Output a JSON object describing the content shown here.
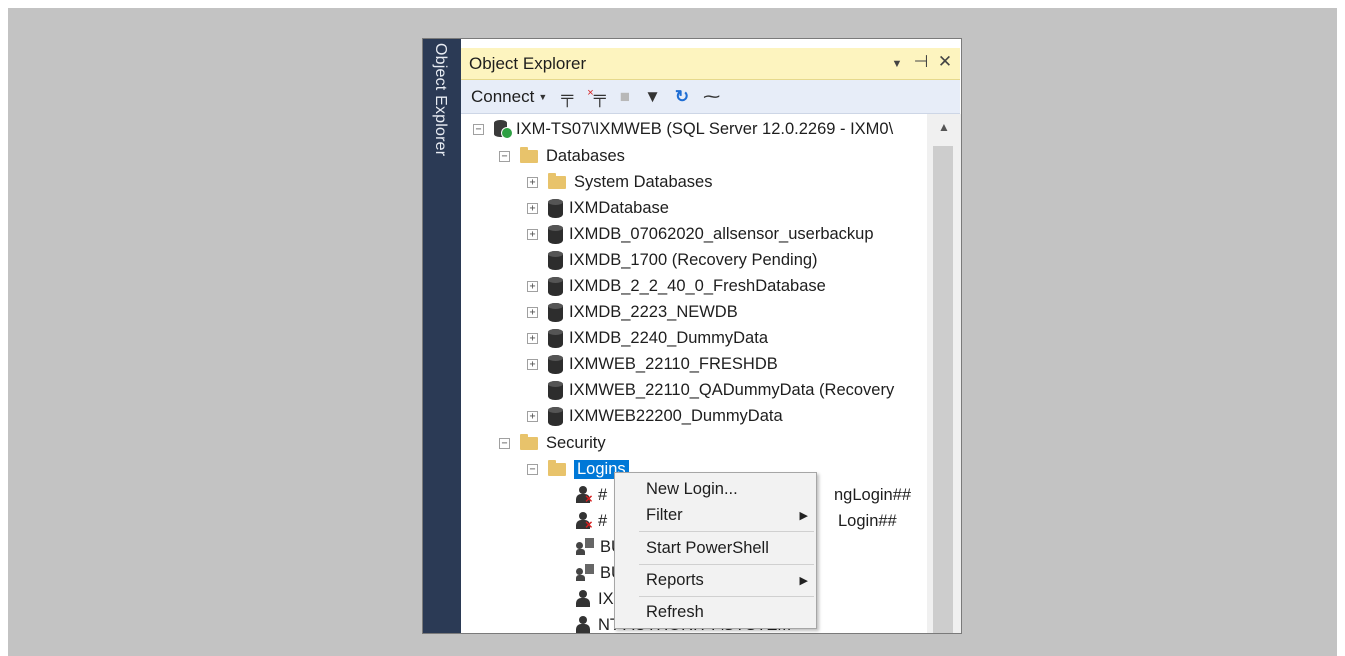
{
  "panel": {
    "side_tab": "Object Explorer",
    "title": "Object Explorer",
    "controls": [
      "▾",
      "⊣",
      "✕"
    ]
  },
  "toolbar": {
    "connect_label": "Connect",
    "icons": [
      "connect-plug-icon",
      "disconnect-icon",
      "stop-icon",
      "filter-icon",
      "refresh-icon",
      "activity-monitor-icon"
    ]
  },
  "tree": {
    "server": "IXM-TS07\\IXMWEB (SQL Server 12.0.2269 - IXM0\\",
    "databases_label": "Databases",
    "databases": [
      {
        "label": "System Databases",
        "type": "folder",
        "expandable": true
      },
      {
        "label": "IXMDatabase",
        "type": "db",
        "expandable": true
      },
      {
        "label": "IXMDB_07062020_allsensor_userbackup",
        "type": "db",
        "expandable": true
      },
      {
        "label": "IXMDB_1700 (Recovery Pending)",
        "type": "db",
        "expandable": false
      },
      {
        "label": "IXMDB_2_2_40_0_FreshDatabase",
        "type": "db",
        "expandable": true
      },
      {
        "label": "IXMDB_2223_NEWDB",
        "type": "db",
        "expandable": true
      },
      {
        "label": "IXMDB_2240_DummyData",
        "type": "db",
        "expandable": true
      },
      {
        "label": "IXMWEB_22110_FRESHDB",
        "type": "db",
        "expandable": true
      },
      {
        "label": "IXMWEB_22110_QADummyData (Recovery",
        "type": "db",
        "expandable": false
      },
      {
        "label": "IXMWEB22200_DummyData",
        "type": "db",
        "expandable": true
      }
    ],
    "security_label": "Security",
    "logins_label": "Logins",
    "logins": [
      {
        "label": "##MS_PolicyEventProcessingLogin##",
        "visible_prefix": "#",
        "visible_suffix": "ngLogin##",
        "type": "user-disabled"
      },
      {
        "label": "##MS_PolicyTsqlExecutionLogin##",
        "visible_prefix": "#",
        "visible_suffix": "Login##",
        "type": "user-disabled"
      },
      {
        "label": "BU",
        "visible_prefix": "BU",
        "visible_suffix": "",
        "type": "group"
      },
      {
        "label": "BU",
        "visible_prefix": "BU",
        "visible_suffix": "",
        "type": "group"
      },
      {
        "label": "IX",
        "visible_prefix": "IX",
        "visible_suffix": "",
        "type": "user"
      },
      {
        "label": "NT AUTHORITY\\SYSTEM",
        "visible_prefix": "NT AUTHORITY\\SYSTEM",
        "visible_suffix": "",
        "type": "user"
      }
    ]
  },
  "context_menu": {
    "items": [
      {
        "label": "New Login...",
        "submenu": false
      },
      {
        "label": "Filter",
        "submenu": true
      },
      {
        "label": "Start PowerShell",
        "submenu": false
      },
      {
        "label": "Reports",
        "submenu": true
      },
      {
        "label": "Refresh",
        "submenu": false
      }
    ]
  }
}
